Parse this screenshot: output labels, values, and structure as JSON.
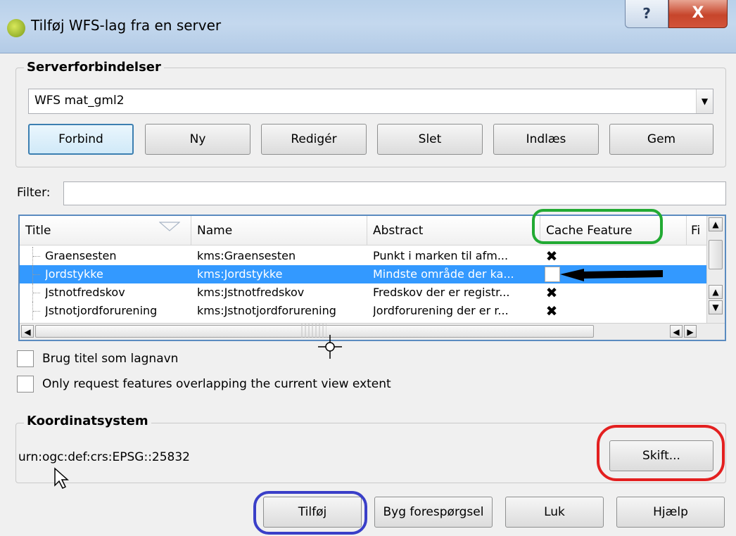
{
  "window": {
    "title": "Tilføj WFS-lag fra en server",
    "help_label": "?",
    "close_label": "X"
  },
  "server": {
    "group_title": "Serverforbindelser",
    "selected": "WFS mat_gml2",
    "buttons": [
      "Forbind",
      "Ny",
      "Redigér",
      "Slet",
      "Indlæs",
      "Gem"
    ]
  },
  "filter": {
    "label": "Filter:",
    "value": ""
  },
  "table": {
    "columns": [
      "Title",
      "Name",
      "Abstract",
      "Cache Feature",
      "Fi"
    ],
    "rows": [
      {
        "title": "Graensesten",
        "name": "kms:Graensesten",
        "abstract": "Punkt i marken til afm...",
        "cache": true
      },
      {
        "title": "Jordstykke",
        "name": "kms:Jordstykke",
        "abstract": "Mindste område der ka...",
        "cache": false
      },
      {
        "title": "Jstnotfredskov",
        "name": "kms:Jstnotfredskov",
        "abstract": "Fredskov der er registr...",
        "cache": true
      },
      {
        "title": "Jstnotjordforurening",
        "name": "kms:Jstnotjordforurening",
        "abstract": "Jordforurening der er r...",
        "cache": true
      }
    ],
    "selected_row": 1
  },
  "options": {
    "use_title": "Brug titel som lagnavn",
    "only_extent": "Only request features overlapping the current view extent"
  },
  "crs": {
    "group_title": "Koordinatsystem",
    "value": "urn:ogc:def:crs:EPSG::25832",
    "change_label": "Skift..."
  },
  "footer": {
    "add": "Tilføj",
    "build_query": "Byg forespørgsel",
    "close": "Luk",
    "help": "Hjælp"
  },
  "annotations": {
    "green": "#22aa33",
    "red": "#e32020",
    "blue": "#3a3fc8",
    "arrow": "#000000"
  }
}
